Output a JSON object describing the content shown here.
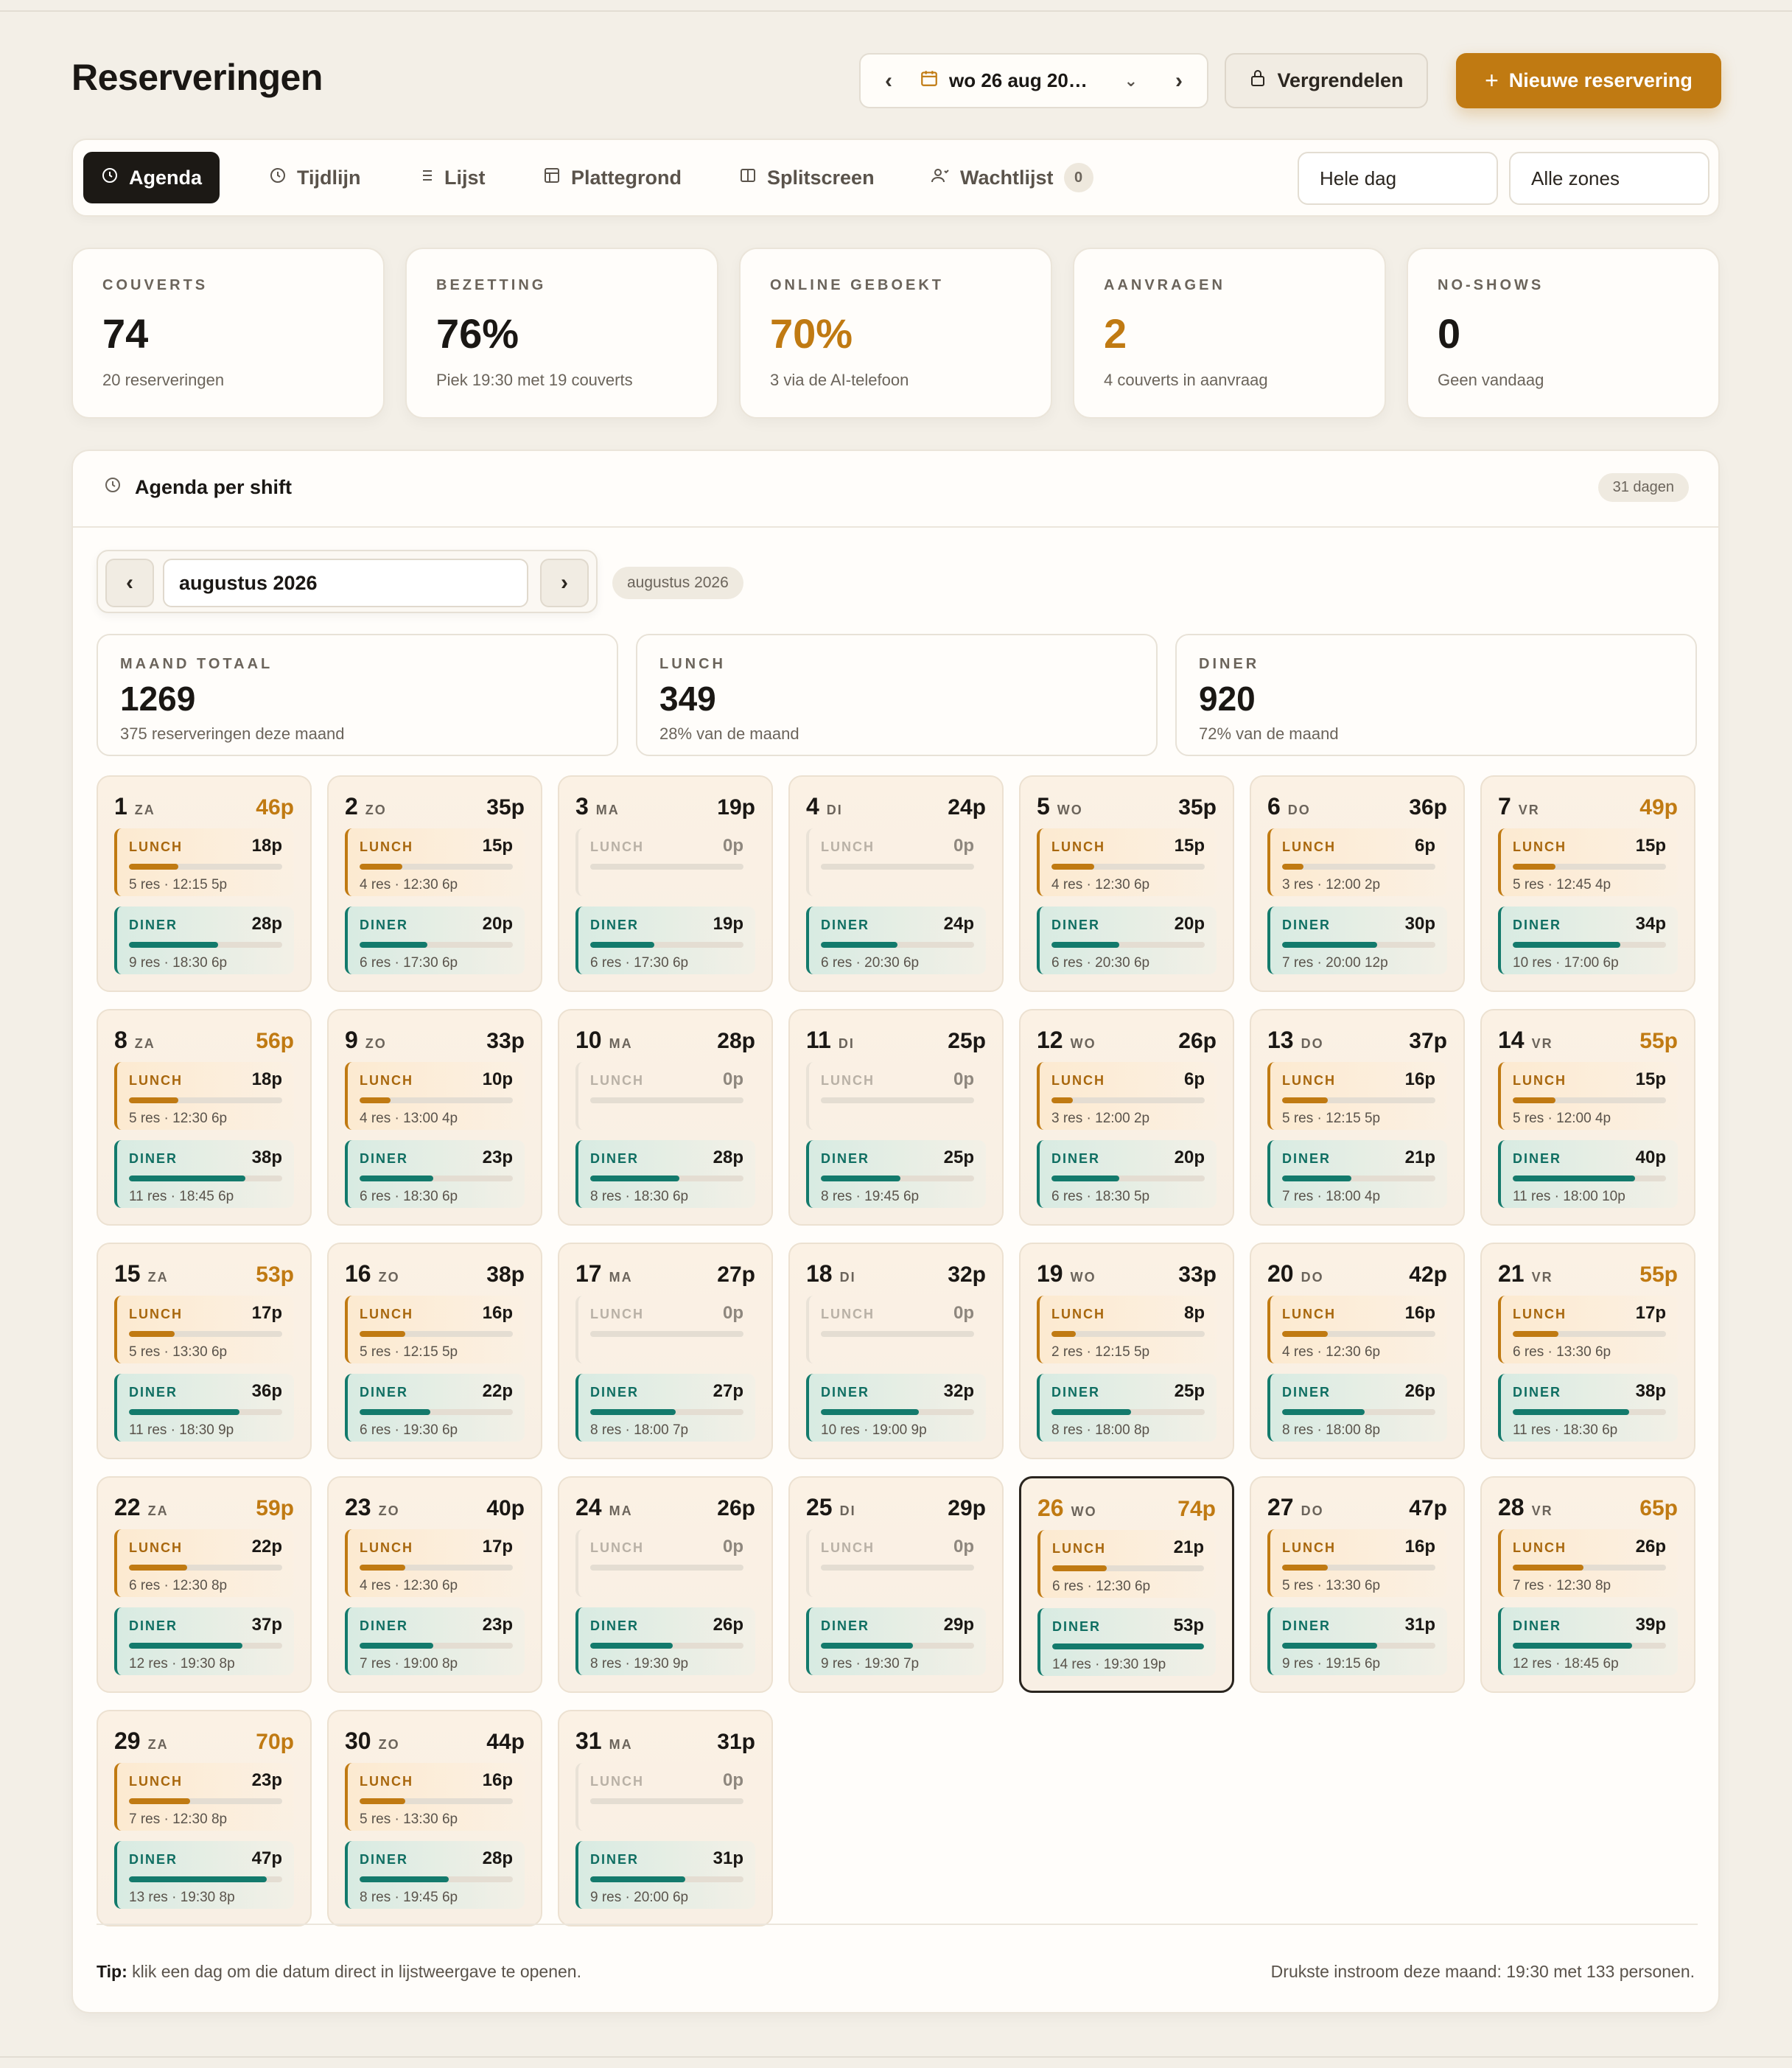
{
  "page": {
    "title": "Reserveringen"
  },
  "header": {
    "date_label": "wo 26 aug 20…",
    "lock_label": "Vergrendelen",
    "new_label": "Nieuwe reservering"
  },
  "tabs": [
    {
      "label": "Agenda",
      "icon": "clock-icon",
      "active": true
    },
    {
      "label": "Tijdlijn",
      "icon": "clock-icon"
    },
    {
      "label": "Lijst",
      "icon": "list-icon"
    },
    {
      "label": "Plattegrond",
      "icon": "floorplan-icon"
    },
    {
      "label": "Splitscreen",
      "icon": "splitscreen-icon"
    },
    {
      "label": "Wachtlijst",
      "icon": "user-icon",
      "badge": "0"
    }
  ],
  "filters": {
    "time": "Hele dag",
    "zones": "Alle zones"
  },
  "stats": [
    {
      "label": "COUVERTS",
      "value": "74",
      "sub": "20 reserveringen"
    },
    {
      "label": "BEZETTING",
      "value": "76%",
      "sub": "Piek 19:30 met 19 couverts"
    },
    {
      "label": "ONLINE GEBOEKT",
      "value": "70%",
      "sub": "3 via de AI-telefoon"
    },
    {
      "label": "AANVRAGEN",
      "value": "2",
      "sub": "4 couverts in aanvraag"
    },
    {
      "label": "NO-SHOWS",
      "value": "0",
      "sub": "Geen vandaag"
    }
  ],
  "agenda": {
    "title": "Agenda per shift",
    "days_pill": "31 dagen",
    "month": "augustus 2026",
    "month_pill": "augustus 2026",
    "summary": [
      {
        "label": "MAAND TOTAAL",
        "value": "1269",
        "sub": "375 reserveringen deze maand"
      },
      {
        "label": "LUNCH",
        "value": "349",
        "sub": "28% van de maand"
      },
      {
        "label": "DINER",
        "value": "920",
        "sub": "72% van de maand"
      }
    ],
    "lunch_label": "LUNCH",
    "diner_label": "DINER",
    "days": [
      {
        "n": "1",
        "d": "ZA",
        "total": "46p",
        "l": "18p",
        "ld": "5 res · 12:15 5p",
        "lf": 0.32,
        "dn": "28p",
        "dd": "9 res · 18:30 6p",
        "df": 0.58
      },
      {
        "n": "2",
        "d": "ZO",
        "total": "35p",
        "l": "15p",
        "ld": "4 res · 12:30 6p",
        "lf": 0.28,
        "dn": "20p",
        "dd": "6 res · 17:30 6p",
        "df": 0.44
      },
      {
        "n": "3",
        "d": "MA",
        "total": "19p",
        "l": "0p",
        "ld": "",
        "lf": 0,
        "dn": "19p",
        "dd": "6 res · 17:30 6p",
        "df": 0.42
      },
      {
        "n": "4",
        "d": "DI",
        "total": "24p",
        "l": "0p",
        "ld": "",
        "lf": 0,
        "dn": "24p",
        "dd": "6 res · 20:30 6p",
        "df": 0.5
      },
      {
        "n": "5",
        "d": "WO",
        "total": "35p",
        "l": "15p",
        "ld": "4 res · 12:30 6p",
        "lf": 0.28,
        "dn": "20p",
        "dd": "6 res · 20:30 6p",
        "df": 0.44
      },
      {
        "n": "6",
        "d": "DO",
        "total": "36p",
        "l": "6p",
        "ld": "3 res · 12:00 2p",
        "lf": 0.14,
        "dn": "30p",
        "dd": "7 res · 20:00 12p",
        "df": 0.62
      },
      {
        "n": "7",
        "d": "VR",
        "total": "49p",
        "l": "15p",
        "ld": "5 res · 12:45 4p",
        "lf": 0.28,
        "dn": "34p",
        "dd": "10 res · 17:00 6p",
        "df": 0.7
      },
      {
        "n": "8",
        "d": "ZA",
        "total": "56p",
        "l": "18p",
        "ld": "5 res · 12:30 6p",
        "lf": 0.32,
        "dn": "38p",
        "dd": "11 res · 18:45 6p",
        "df": 0.76
      },
      {
        "n": "9",
        "d": "ZO",
        "total": "33p",
        "l": "10p",
        "ld": "4 res · 13:00 4p",
        "lf": 0.2,
        "dn": "23p",
        "dd": "6 res · 18:30 6p",
        "df": 0.48
      },
      {
        "n": "10",
        "d": "MA",
        "total": "28p",
        "l": "0p",
        "ld": "",
        "lf": 0,
        "dn": "28p",
        "dd": "8 res · 18:30 6p",
        "df": 0.58
      },
      {
        "n": "11",
        "d": "DI",
        "total": "25p",
        "l": "0p",
        "ld": "",
        "lf": 0,
        "dn": "25p",
        "dd": "8 res · 19:45 6p",
        "df": 0.52
      },
      {
        "n": "12",
        "d": "WO",
        "total": "26p",
        "l": "6p",
        "ld": "3 res · 12:00 2p",
        "lf": 0.14,
        "dn": "20p",
        "dd": "6 res · 18:30 5p",
        "df": 0.44
      },
      {
        "n": "13",
        "d": "DO",
        "total": "37p",
        "l": "16p",
        "ld": "5 res · 12:15 5p",
        "lf": 0.3,
        "dn": "21p",
        "dd": "7 res · 18:00 4p",
        "df": 0.45
      },
      {
        "n": "14",
        "d": "VR",
        "total": "55p",
        "l": "15p",
        "ld": "5 res · 12:00 4p",
        "lf": 0.28,
        "dn": "40p",
        "dd": "11 res · 18:00 10p",
        "df": 0.8
      },
      {
        "n": "15",
        "d": "ZA",
        "total": "53p",
        "l": "17p",
        "ld": "5 res · 13:30 6p",
        "lf": 0.3,
        "dn": "36p",
        "dd": "11 res · 18:30 9p",
        "df": 0.72
      },
      {
        "n": "16",
        "d": "ZO",
        "total": "38p",
        "l": "16p",
        "ld": "5 res · 12:15 5p",
        "lf": 0.3,
        "dn": "22p",
        "dd": "6 res · 19:30 6p",
        "df": 0.46
      },
      {
        "n": "17",
        "d": "MA",
        "total": "27p",
        "l": "0p",
        "ld": "",
        "lf": 0,
        "dn": "27p",
        "dd": "8 res · 18:00 7p",
        "df": 0.56
      },
      {
        "n": "18",
        "d": "DI",
        "total": "32p",
        "l": "0p",
        "ld": "",
        "lf": 0,
        "dn": "32p",
        "dd": "10 res · 19:00 9p",
        "df": 0.64
      },
      {
        "n": "19",
        "d": "WO",
        "total": "33p",
        "l": "8p",
        "ld": "2 res · 12:15 5p",
        "lf": 0.16,
        "dn": "25p",
        "dd": "8 res · 18:00 8p",
        "df": 0.52
      },
      {
        "n": "20",
        "d": "DO",
        "total": "42p",
        "l": "16p",
        "ld": "4 res · 12:30 6p",
        "lf": 0.3,
        "dn": "26p",
        "dd": "8 res · 18:00 8p",
        "df": 0.54
      },
      {
        "n": "21",
        "d": "VR",
        "total": "55p",
        "l": "17p",
        "ld": "6 res · 13:30 6p",
        "lf": 0.3,
        "dn": "38p",
        "dd": "11 res · 18:30 6p",
        "df": 0.76
      },
      {
        "n": "22",
        "d": "ZA",
        "total": "59p",
        "l": "22p",
        "ld": "6 res · 12:30 8p",
        "lf": 0.38,
        "dn": "37p",
        "dd": "12 res · 19:30 8p",
        "df": 0.74
      },
      {
        "n": "23",
        "d": "ZO",
        "total": "40p",
        "l": "17p",
        "ld": "4 res · 12:30 6p",
        "lf": 0.3,
        "dn": "23p",
        "dd": "7 res · 19:00 8p",
        "df": 0.48
      },
      {
        "n": "24",
        "d": "MA",
        "total": "26p",
        "l": "0p",
        "ld": "",
        "lf": 0,
        "dn": "26p",
        "dd": "8 res · 19:30 9p",
        "df": 0.54
      },
      {
        "n": "25",
        "d": "DI",
        "total": "29p",
        "l": "0p",
        "ld": "",
        "lf": 0,
        "dn": "29p",
        "dd": "9 res · 19:30 7p",
        "df": 0.6
      },
      {
        "n": "26",
        "d": "WO",
        "total": "74p",
        "l": "21p",
        "ld": "6 res · 12:30 6p",
        "lf": 0.36,
        "dn": "53p",
        "dd": "14 res · 19:30 19p",
        "df": 1.0,
        "selected": true
      },
      {
        "n": "27",
        "d": "DO",
        "total": "47p",
        "l": "16p",
        "ld": "5 res · 13:30 6p",
        "lf": 0.3,
        "dn": "31p",
        "dd": "9 res · 19:15 6p",
        "df": 0.62
      },
      {
        "n": "28",
        "d": "VR",
        "total": "65p",
        "l": "26p",
        "ld": "7 res · 12:30 8p",
        "lf": 0.46,
        "dn": "39p",
        "dd": "12 res · 18:45 6p",
        "df": 0.78
      },
      {
        "n": "29",
        "d": "ZA",
        "total": "70p",
        "l": "23p",
        "ld": "7 res · 12:30 8p",
        "lf": 0.4,
        "dn": "47p",
        "dd": "13 res · 19:30 8p",
        "df": 0.9
      },
      {
        "n": "30",
        "d": "ZO",
        "total": "44p",
        "l": "16p",
        "ld": "5 res · 13:30 6p",
        "lf": 0.3,
        "dn": "28p",
        "dd": "8 res · 19:45 6p",
        "df": 0.58
      },
      {
        "n": "31",
        "d": "MA",
        "total": "31p",
        "l": "0p",
        "ld": "",
        "lf": 0,
        "dn": "31p",
        "dd": "9 res · 20:00 6p",
        "df": 0.62
      }
    ],
    "tip_bold": "Tip:",
    "tip_text": " klik een dag om die datum direct in lijstweergave te openen.",
    "busiest": "Drukste instroom deze maand: 19:30 met 133 personen."
  },
  "colors": {
    "accent": "#c07a12",
    "teal": "#137a6c",
    "dark": "#1c1915"
  }
}
